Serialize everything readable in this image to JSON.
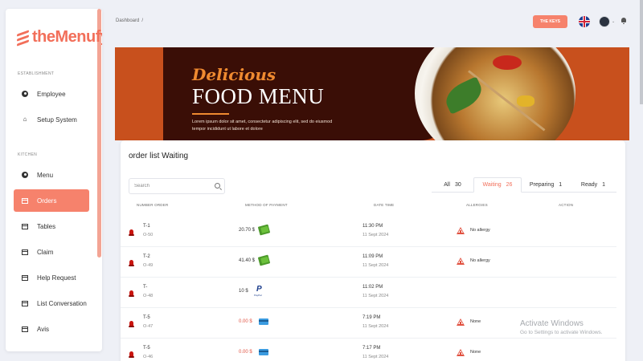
{
  "brand": {
    "name": "theMenufy",
    "accent": "#f6826c"
  },
  "sidebar": {
    "sections": [
      {
        "label": "ESTABLISHMENT"
      },
      {
        "label": "KITCHEN"
      }
    ],
    "items": [
      {
        "label": "Employee",
        "icon": "user-icon",
        "active": false
      },
      {
        "label": "Setup System",
        "icon": "home-icon",
        "active": false
      },
      {
        "label": "Menu",
        "icon": "user-icon",
        "active": false
      },
      {
        "label": "Orders",
        "icon": "table-icon",
        "active": true
      },
      {
        "label": "Tables",
        "icon": "table-icon",
        "active": false
      },
      {
        "label": "Claim",
        "icon": "table-icon",
        "active": false
      },
      {
        "label": "Help Request",
        "icon": "table-icon",
        "active": false
      },
      {
        "label": "List Conversation",
        "icon": "table-icon",
        "active": false
      },
      {
        "label": "Avis",
        "icon": "table-icon",
        "active": false
      }
    ]
  },
  "header": {
    "breadcrumb": "Dashboard",
    "breadcrumb_sep": "/",
    "keys_button": "THE KEYS",
    "language_flag": "uk-flag-icon"
  },
  "banner": {
    "title_script": "Delicious",
    "title_main": "FOOD MENU",
    "description": "Lorem ipsum dolor sit amet, consectetur adipiscing elit, sed do eiusmod tempor incididunt ut labore et dolore"
  },
  "orders": {
    "title": "order list Waiting",
    "search_placeholder": "Search",
    "tabs": [
      {
        "label": "All",
        "count": "30",
        "active": false
      },
      {
        "label": "Waiting",
        "count": "26",
        "active": true
      },
      {
        "label": "Preparing",
        "count": "1",
        "active": false
      },
      {
        "label": "Ready",
        "count": "1",
        "active": false
      }
    ],
    "columns": [
      "NUMBER ORDER",
      "METHOD OF PAYMENT",
      "DATE TIME",
      "ALLERGIES",
      "ACTION"
    ],
    "rows": [
      {
        "table": "T-1",
        "order": "O-50",
        "amount": "20.70 $",
        "payment": "cash-icon",
        "time": "11:30 PM",
        "date": "11 Sept 2024",
        "allergy": "No allergy"
      },
      {
        "table": "T-2",
        "order": "O-49",
        "amount": "41.40 $",
        "payment": "cash-icon",
        "time": "11:09 PM",
        "date": "11 Sept 2024",
        "allergy": "No allergy"
      },
      {
        "table": "T-",
        "order": "O-48",
        "amount": "10 $",
        "payment": "paypal-icon",
        "time": "11:02 PM",
        "date": "11 Sept 2024",
        "allergy": ""
      },
      {
        "table": "T-5",
        "order": "O-47",
        "amount": "0.00 $",
        "payment": "card-icon",
        "time": "7:19 PM",
        "date": "11 Sept 2024",
        "allergy": "None"
      },
      {
        "table": "T-5",
        "order": "O-46",
        "amount": "0.00 $",
        "payment": "card-icon",
        "time": "7:17 PM",
        "date": "11 Sept 2024",
        "allergy": "None"
      }
    ]
  },
  "watermark": {
    "line1": "Activate Windows",
    "line2": "Go to Settings to activate Windows."
  }
}
